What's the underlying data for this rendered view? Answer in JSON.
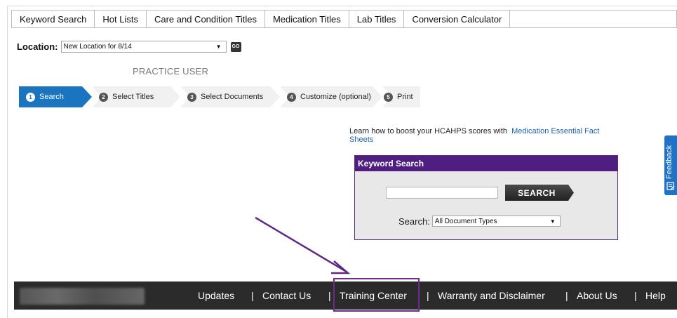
{
  "tabs": [
    {
      "label": "Keyword Search"
    },
    {
      "label": "Hot Lists"
    },
    {
      "label": "Care and Condition Titles"
    },
    {
      "label": "Medication Titles"
    },
    {
      "label": "Lab Titles"
    },
    {
      "label": "Conversion Calculator"
    }
  ],
  "location": {
    "label": "Location:",
    "value": "New Location for 8/14",
    "go_label": "GO"
  },
  "user": {
    "name": "PRACTICE USER"
  },
  "steps": [
    {
      "num": "1",
      "label": "Search",
      "active": true
    },
    {
      "num": "2",
      "label": "Select Titles",
      "active": false
    },
    {
      "num": "3",
      "label": "Select Documents",
      "active": false
    },
    {
      "num": "4",
      "label": "Customize (optional)",
      "active": false
    },
    {
      "num": "5",
      "label": "Print",
      "active": false
    }
  ],
  "promo": {
    "text": "Learn how to boost your HCAHPS scores with",
    "link": "Medication Essential Fact Sheets"
  },
  "keyword_search": {
    "title": "Keyword Search",
    "input_value": "",
    "button_label": "SEARCH",
    "type_label": "Search:",
    "type_value": "All Document Types"
  },
  "feedback": {
    "label": "Feedback"
  },
  "footer": {
    "links": [
      {
        "label": "Updates"
      },
      {
        "label": "Contact Us"
      },
      {
        "label": "Training Center"
      },
      {
        "label": "Warranty and Disclaimer"
      },
      {
        "label": "About Us"
      },
      {
        "label": "Help"
      }
    ],
    "separator": "|"
  },
  "colors": {
    "accent_blue": "#1b74c0",
    "header_purple": "#4e1f80",
    "annotation_purple": "#6e2b8e",
    "footer_bg": "#2b2b2b"
  }
}
